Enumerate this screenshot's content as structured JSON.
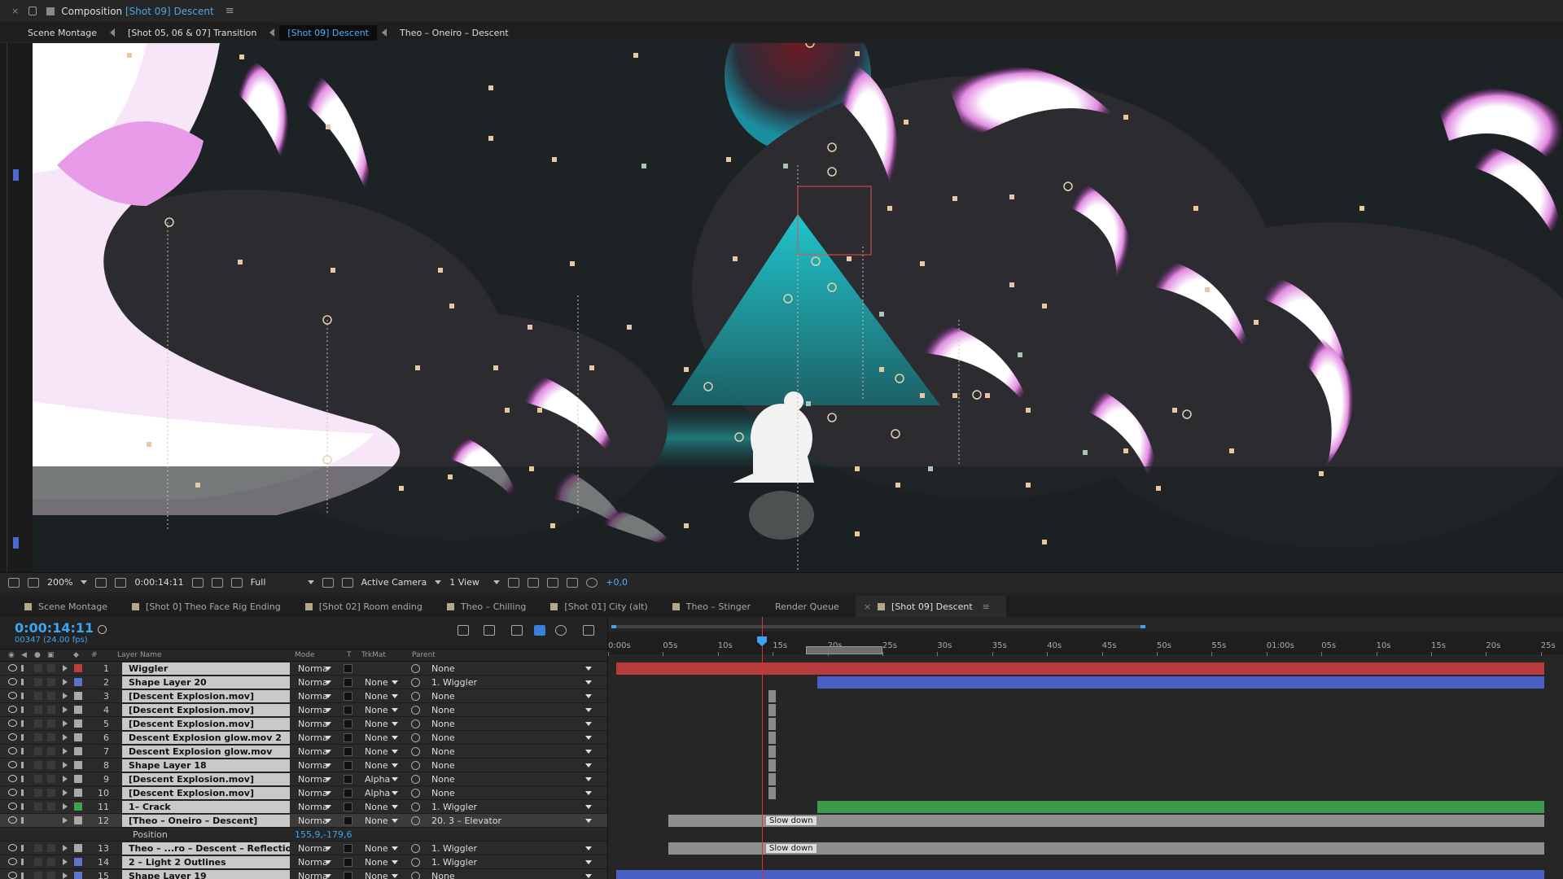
{
  "composition": {
    "panel_label": "Composition",
    "name": "[Shot 09] Descent"
  },
  "breadcrumbs": [
    {
      "label": "Scene Montage",
      "active": false
    },
    {
      "label": "[Shot 05, 06 & 07] Transition",
      "active": false
    },
    {
      "label": "[Shot 09] Descent",
      "active": true
    },
    {
      "label": "Theo – Oneiro – Descent",
      "active": false
    }
  ],
  "viewer": {
    "zoom": "200%",
    "timecode": "0:00:14:11",
    "resolution": "Full",
    "camera": "Active Camera",
    "views": "1 View",
    "exposure": "+0,0"
  },
  "tabs": [
    {
      "label": "Scene Montage",
      "active": false
    },
    {
      "label": "[Shot 0]  Theo Face Rig Ending",
      "active": false
    },
    {
      "label": "[Shot 02] Room ending",
      "active": false
    },
    {
      "label": "Theo – Chilling",
      "active": false
    },
    {
      "label": "[Shot 01] City (alt)",
      "active": false
    },
    {
      "label": "Theo – Stinger",
      "active": false
    },
    {
      "label": "Render Queue",
      "active": false
    },
    {
      "label": "[Shot 09] Descent",
      "active": true
    }
  ],
  "timeline": {
    "current_time": "0:00:14:11",
    "frame_info": "00347 (24.00 fps)",
    "columns": {
      "layer_name": "Layer Name",
      "hash": "#",
      "mode": "Mode",
      "t": "T",
      "trkmat": "TrkMat",
      "parent": "Parent"
    },
    "ruler_ticks": [
      "0:00s",
      "05s",
      "10s",
      "15s",
      "20s",
      "25s",
      "30s",
      "35s",
      "40s",
      "45s",
      "50s",
      "55s",
      "01:00s",
      "05s",
      "10s",
      "15s",
      "20s",
      "25s"
    ],
    "marker_label": "Slow down",
    "playhead_time_s": 14.46
  },
  "layers": [
    {
      "num": "1",
      "name": "Wiggler",
      "color": "#c23a3a",
      "mode": "Norma",
      "trkmat": "",
      "parent": "None",
      "bar": {
        "start": 0.0,
        "end": 1.0,
        "color": "#b83c3c"
      }
    },
    {
      "num": "2",
      "name": "Shape Layer 20",
      "color": "#5d72c9",
      "mode": "Norma",
      "trkmat": "None",
      "parent": "1. Wiggler",
      "bar": {
        "start": 0.217,
        "end": 1.0,
        "color": "#4a5fc4"
      }
    },
    {
      "num": "3",
      "name": "[Descent Explosion.mov]",
      "color": "#a9a9a9",
      "mode": "Norma",
      "trkmat": "None",
      "parent": "None",
      "bar": {
        "start": 0.164,
        "end": 0.172,
        "color": "#8a8a8a"
      }
    },
    {
      "num": "4",
      "name": "[Descent Explosion.mov]",
      "color": "#a9a9a9",
      "mode": "Norma",
      "trkmat": "None",
      "parent": "None",
      "bar": {
        "start": 0.164,
        "end": 0.172,
        "color": "#8a8a8a"
      }
    },
    {
      "num": "5",
      "name": "[Descent Explosion.mov]",
      "color": "#a9a9a9",
      "mode": "Norma",
      "trkmat": "None",
      "parent": "None",
      "bar": {
        "start": 0.164,
        "end": 0.172,
        "color": "#8a8a8a"
      }
    },
    {
      "num": "6",
      "name": "Descent Explosion glow.mov 2",
      "color": "#a9a9a9",
      "mode": "Norma",
      "trkmat": "None",
      "parent": "None",
      "bar": {
        "start": 0.164,
        "end": 0.172,
        "color": "#8a8a8a"
      }
    },
    {
      "num": "7",
      "name": "Descent Explosion glow.mov",
      "color": "#a9a9a9",
      "mode": "Norma",
      "trkmat": "None",
      "parent": "None",
      "bar": {
        "start": 0.164,
        "end": 0.172,
        "color": "#8a8a8a"
      }
    },
    {
      "num": "8",
      "name": "Shape Layer 18",
      "color": "#a9a9a9",
      "mode": "Norma",
      "trkmat": "None",
      "parent": "None",
      "bar": {
        "start": 0.164,
        "end": 0.172,
        "color": "#8a8a8a"
      }
    },
    {
      "num": "9",
      "name": "[Descent Explosion.mov]",
      "color": "#a9a9a9",
      "mode": "Norma",
      "trkmat": "Alpha",
      "parent": "None",
      "bar": {
        "start": 0.164,
        "end": 0.172,
        "color": "#8a8a8a"
      }
    },
    {
      "num": "10",
      "name": "[Descent Explosion.mov]",
      "color": "#a9a9a9",
      "mode": "Norma",
      "trkmat": "Alpha",
      "parent": "None",
      "bar": {
        "start": 0.164,
        "end": 0.172,
        "color": "#8a8a8a"
      }
    },
    {
      "num": "11",
      "name": "1– Crack",
      "color": "#3fa14b",
      "mode": "Norma",
      "trkmat": "None",
      "parent": "1. Wiggler",
      "bar": {
        "start": 0.217,
        "end": 1.0,
        "color": "#3d9a4c"
      }
    },
    {
      "num": "12",
      "name": "[Theo – Oneiro – Descent]",
      "color": "#a9a9a9",
      "mode": "Norma",
      "trkmat": "None",
      "parent": "20. 3 – Elevator",
      "bar": {
        "start": 0.056,
        "end": 1.0,
        "color": "#8f8f8f"
      }
    },
    {
      "num": "13",
      "name": "Theo – ...ro – Descent – Reflection",
      "color": "#a9a9a9",
      "mode": "Norma",
      "trkmat": "None",
      "parent": "1. Wiggler",
      "bar": {
        "start": 0.056,
        "end": 1.0,
        "color": "#8f8f8f"
      }
    },
    {
      "num": "14",
      "name": "2 – Light 2 Outlines",
      "color": "#5d72c9",
      "mode": "Norma",
      "trkmat": "None",
      "parent": "1. Wiggler",
      "bar": {
        "start": 0.0,
        "end": 0.0,
        "color": "#4a5fc4"
      }
    },
    {
      "num": "15",
      "name": "Shape Layer 19",
      "color": "#5d72c9",
      "mode": "Norma",
      "trkmat": "None",
      "parent": "None",
      "bar": {
        "start": 0.0,
        "end": 1.0,
        "color": "#4a5fc4"
      }
    }
  ],
  "property": {
    "name": "Position",
    "value": "155,9,-179,6"
  },
  "colors": {
    "accent": "#3aa5f5",
    "scene_bg": "#1b2427",
    "magenta_glow": "#c13ac0",
    "teal_beam": "#1ec8d2"
  }
}
